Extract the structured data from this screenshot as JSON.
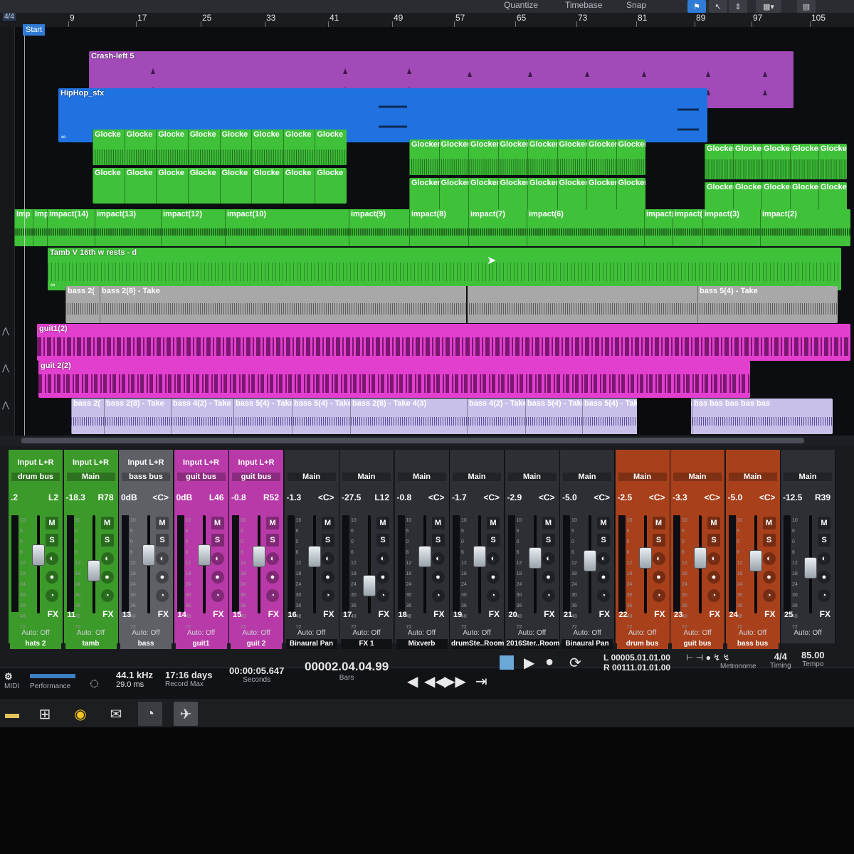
{
  "toolbar": {
    "quantize_label": "Quantize",
    "timebase_label": "Timebase",
    "snap_label": "Snap"
  },
  "ruler": {
    "time_signature": "4/4",
    "start_marker": "Start",
    "bars": [
      "9",
      "17",
      "25",
      "33",
      "41",
      "49",
      "57",
      "65",
      "73",
      "81",
      "89",
      "97",
      "105"
    ]
  },
  "tracks": {
    "crash": {
      "name": "Crash-left 5"
    },
    "hiphop": {
      "name": "HipHop_sfx"
    },
    "glock": {
      "segment_label": "Glocke",
      "segment_label_alt": "Glocker"
    },
    "impact": {
      "labels": [
        "Imp",
        "Imp",
        "impact(14)",
        "impact(13)",
        "impact(12)",
        "impact(10)",
        "impact(9)",
        "impact(8)",
        "impact(7)",
        "impact(6)",
        "impact(",
        "impact(",
        "impact(3)",
        "impact(2)"
      ]
    },
    "tamb": {
      "name": "Tamb V 16th w rests - d"
    },
    "bass_upper": {
      "labels": [
        "bass 2(",
        "bass 2(8) - Take",
        "bass 5(4) - Take"
      ]
    },
    "guit1": {
      "name": "guit1(2)"
    },
    "guit2": {
      "name": "guit 2(2)"
    },
    "bass_lower": {
      "labels": [
        "bass 2(",
        "bass 2(8) - Take",
        "bass 4(2) - Take",
        "bass 5(4) - Take",
        "bass 5(4) - Take",
        "bass 2(8) - Take 4(3)",
        "bass 4(2) - Take",
        "bass 5(4) - Take",
        "bass 5(4) - Take",
        "bass 5(4) - Take",
        "bas bas bas bas bas"
      ]
    }
  },
  "mixer": {
    "auto_off": "Auto: Off",
    "mute": "M",
    "solo": "S",
    "fx_label": "FX",
    "scale": [
      "10",
      "6",
      "0",
      "6",
      "12",
      "18",
      "24",
      "30",
      "36",
      "48",
      "72"
    ],
    "strips": [
      {
        "input": "Input L+R",
        "bus": "drum bus",
        "vol": ".2",
        "pan": "L2",
        "num": "",
        "name": "hats 2",
        "color": "#3c9a2a",
        "fader": 0.62
      },
      {
        "input": "Input L+R",
        "bus": "Main",
        "vol": "-18.3",
        "pan": "R78",
        "num": "11",
        "name": "tamb",
        "color": "#3c9a2a",
        "fader": 0.42
      },
      {
        "input": "Input L+R",
        "bus": "bass bus",
        "vol": "0dB",
        "pan": "<C>",
        "num": "13",
        "name": "bass",
        "color": "#5e6066",
        "fader": 0.62
      },
      {
        "input": "Input L+R",
        "bus": "guit bus",
        "vol": "0dB",
        "pan": "L46",
        "num": "14",
        "name": "guit1",
        "color": "#b83aa8",
        "fader": 0.62
      },
      {
        "input": "Input L+R",
        "bus": "guit bus",
        "vol": "-0.8",
        "pan": "R52",
        "num": "15",
        "name": "guit 2",
        "color": "#b83aa8",
        "fader": 0.6
      },
      {
        "input": "",
        "bus": "Main",
        "vol": "-1.3",
        "pan": "<C>",
        "num": "16",
        "name": "Binaural Pan",
        "color": "#2d2f35",
        "fader": 0.6
      },
      {
        "input": "",
        "bus": "Main",
        "vol": "-27.5",
        "pan": "L12",
        "num": "17",
        "name": "FX 1",
        "color": "#2d2f35",
        "fader": 0.22
      },
      {
        "input": "",
        "bus": "Main",
        "vol": "-0.8",
        "pan": "<C>",
        "num": "18",
        "name": "Mixverb",
        "color": "#2d2f35",
        "fader": 0.6
      },
      {
        "input": "",
        "bus": "Main",
        "vol": "-1.7",
        "pan": "<C>",
        "num": "19",
        "name": "drumSte..Room",
        "color": "#2d2f35",
        "fader": 0.6
      },
      {
        "input": "",
        "bus": "Main",
        "vol": "-2.9",
        "pan": "<C>",
        "num": "20",
        "name": "2016Ster..Room",
        "color": "#2d2f35",
        "fader": 0.58
      },
      {
        "input": "",
        "bus": "Main",
        "vol": "-5.0",
        "pan": "<C>",
        "num": "21",
        "name": "Binaural Pan",
        "color": "#2d2f35",
        "fader": 0.55
      },
      {
        "input": "",
        "bus": "Main",
        "vol": "-2.5",
        "pan": "<C>",
        "num": "22",
        "name": "drum bus",
        "color": "#a8401c",
        "fader": 0.58
      },
      {
        "input": "",
        "bus": "Main",
        "vol": "-3.3",
        "pan": "<C>",
        "num": "23",
        "name": "guit bus",
        "color": "#a8401c",
        "fader": 0.58
      },
      {
        "input": "",
        "bus": "Main",
        "vol": "-5.0",
        "pan": "<C>",
        "num": "24",
        "name": "bass bus",
        "color": "#a8401c",
        "fader": 0.55
      },
      {
        "input": "",
        "bus": "Main",
        "vol": "-12.5",
        "pan": "R39",
        "num": "25",
        "name": "",
        "color": "#2d2f35",
        "fader": 0.45
      }
    ]
  },
  "transport": {
    "midi": "MIDI",
    "performance": "Performance",
    "sample_rate": "44.1 kHz",
    "latency": "29.0 ms",
    "record_max_value": "17:16 days",
    "record_max_label": "Record Max",
    "seconds_value": "00:00:05.647",
    "seconds_label": "Seconds",
    "bars_value": "00002.04.04.99",
    "bars_label": "Bars",
    "loop_left": "L  00005.01.01.00",
    "loop_right": "R  00111.01.01.00",
    "metronome_label": "Metronome",
    "timing_value": "4/4",
    "timing_label": "Timing",
    "tempo_value": "85.00",
    "tempo_label": "Tempo"
  },
  "colors": {
    "purple": "#a14ab8",
    "blue": "#1f72e0",
    "green": "#3fc13a",
    "magenta": "#e23fcf",
    "grey": "#a8a8a8",
    "lavender": "#c9c0ea"
  }
}
